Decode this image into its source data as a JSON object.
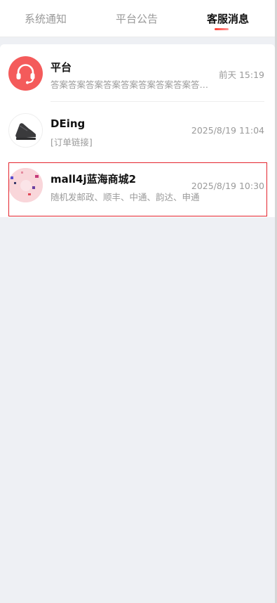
{
  "tabs": [
    {
      "label": "系统通知",
      "active": false
    },
    {
      "label": "平台公告",
      "active": false
    },
    {
      "label": "客服消息",
      "active": true
    }
  ],
  "accent_color": "#e4252e",
  "messages": [
    {
      "avatar_icon": "headset-icon",
      "title": "平台",
      "preview": "答案答案答案答案答案答案答案答案答案答案答案",
      "time": "前天 15:19"
    },
    {
      "avatar_icon": "shoe-rack-product-image",
      "title": "DEing",
      "preview": "[订单链接]",
      "time": "2025/8/19 11:04"
    },
    {
      "avatar_icon": "store-logo-image",
      "title": "mall4j蓝海商城2",
      "preview": "随机发邮政、顺丰、中通、韵达、申通",
      "time": "2025/8/19 10:30",
      "selected": true
    }
  ]
}
